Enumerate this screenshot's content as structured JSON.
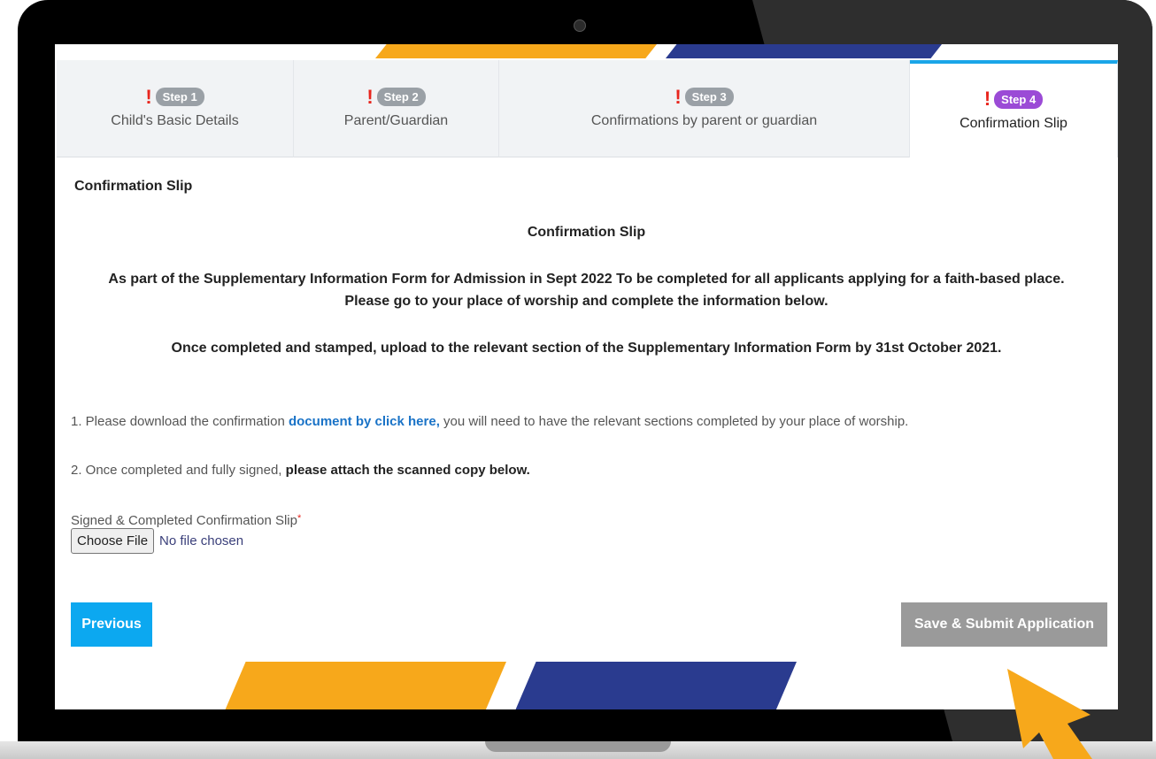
{
  "tabs": [
    {
      "step": "Step 1",
      "label": "Child's Basic Details",
      "active": false
    },
    {
      "step": "Step 2",
      "label": "Parent/Guardian",
      "active": false
    },
    {
      "step": "Step 3",
      "label": "Confirmations by parent or guardian",
      "active": false
    },
    {
      "step": "Step 4",
      "label": "Confirmation Slip",
      "active": true
    }
  ],
  "warning_symbol": "!",
  "section_title": "Confirmation Slip",
  "center_title": "Confirmation Slip",
  "intro": {
    "line1": "As part of the Supplementary Information Form for Admission in Sept 2022 To be completed for all applicants applying for a faith-based place.",
    "line2": "Please go to your place of worship and complete the information below.",
    "line3": "Once completed and stamped, upload to the relevant section of the Supplementary Information Form by 31st October 2021."
  },
  "instructions": {
    "step1_prefix": "1. Please download the confirmation ",
    "step1_link": "document by click here,",
    "step1_suffix": " you will need to have the relevant sections completed by your place of worship.",
    "step2_prefix": "2. Once completed and fully signed, ",
    "step2_bold": "please attach the scanned copy below."
  },
  "upload": {
    "label": "Signed & Completed Confirmation Slip",
    "required_mark": "*",
    "button_label": "Choose File",
    "status": "No file chosen"
  },
  "buttons": {
    "previous": "Previous",
    "submit": "Save & Submit Application"
  },
  "colors": {
    "accent_blue": "#0ca8f0",
    "link_blue": "#1a73c7",
    "active_step_badge": "#9b4bd6",
    "inactive_step_badge": "#9aa0a6",
    "warning_red": "#e8251d",
    "disabled_button": "#9a9a9a",
    "deco_orange": "#f7a81b",
    "deco_navy": "#2a3b8f"
  }
}
